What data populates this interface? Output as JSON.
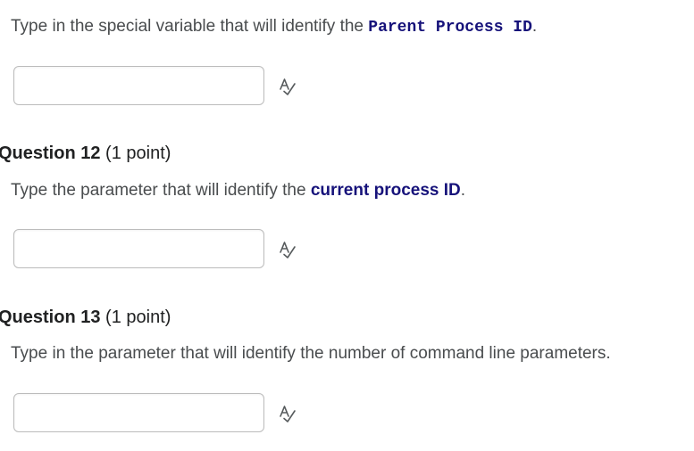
{
  "q11": {
    "prompt_prefix": "Type in the special variable that will identify the ",
    "prompt_highlight": "Parent Process ID",
    "prompt_suffix": ".",
    "answer_value": ""
  },
  "q12": {
    "title": "Question 12",
    "points": " (1 point)",
    "prompt_prefix": "Type the parameter that will identify the ",
    "prompt_highlight": "current process ID",
    "prompt_suffix": ".",
    "answer_value": ""
  },
  "q13": {
    "title": "Question 13",
    "points": " (1 point)",
    "prompt": "Type in the parameter that will identify the number of command line parameters.",
    "answer_value": ""
  },
  "icons": {
    "spellcheck": "spellcheck-icon"
  },
  "colors": {
    "text": "#494c4e",
    "highlight": "#16127a",
    "input_border": "#bcbcbc"
  }
}
